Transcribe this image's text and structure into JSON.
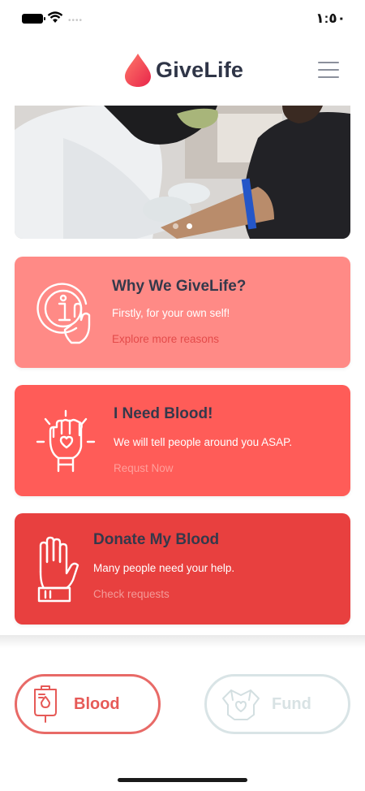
{
  "status_bar": {
    "time": "١:٥٠",
    "signal": "••••"
  },
  "header": {
    "brand": "GiveLife",
    "logo_icon": "blood-drop-icon",
    "menu_icon": "hamburger-menu-icon",
    "brand_color": "#ff4b4b"
  },
  "hero": {
    "slide_count": 2,
    "active_slide": 2
  },
  "cards": [
    {
      "title": "Why We GiveLife?",
      "subtitle": "Firstly, for your own self!",
      "link": "Explore more reasons",
      "icon": "info-tap-icon",
      "color": "#ff8a86"
    },
    {
      "title": "I Need Blood!",
      "subtitle": "We will tell people around you ASAP.",
      "link": "Requst Now",
      "icon": "raised-fist-icon",
      "color": "#ff5c58"
    },
    {
      "title": "Donate My Blood",
      "subtitle": "Many people need your help.",
      "link": "Check requests",
      "icon": "raised-hand-icon",
      "color": "#e8403f"
    }
  ],
  "bottom_tabs": [
    {
      "label": "Blood",
      "icon": "blood-bag-icon",
      "active": true
    },
    {
      "label": "Fund",
      "icon": "handshake-heart-icon",
      "active": false
    }
  ]
}
